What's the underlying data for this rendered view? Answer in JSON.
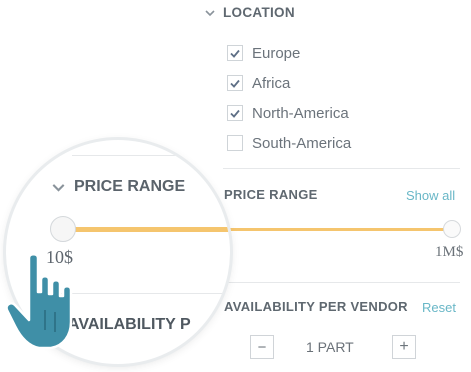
{
  "location": {
    "title": "LOCATION",
    "options": [
      {
        "label": "Europe",
        "checked": true
      },
      {
        "label": "Africa",
        "checked": true
      },
      {
        "label": "North-America",
        "checked": true
      },
      {
        "label": "South-America",
        "checked": false
      }
    ]
  },
  "price_range": {
    "title": "PRICE RANGE",
    "show_all": "Show all",
    "min_label": "10$",
    "max_label": "1M$",
    "min_value_fraction": 0.0,
    "max_value_fraction": 1.0
  },
  "availability": {
    "title": "AVAILABILITY PER VENDOR",
    "reset": "Reset",
    "value": "1 PART",
    "minus": "−",
    "plus": "+"
  },
  "zoom_lens": {
    "price_title": "PRICE RANGE",
    "min_label": "10$",
    "availability_title": "AVAILABILITY P"
  },
  "colors": {
    "accent": "#f5c56e",
    "link": "#69b7c7",
    "hand": "#3f8fa7"
  }
}
